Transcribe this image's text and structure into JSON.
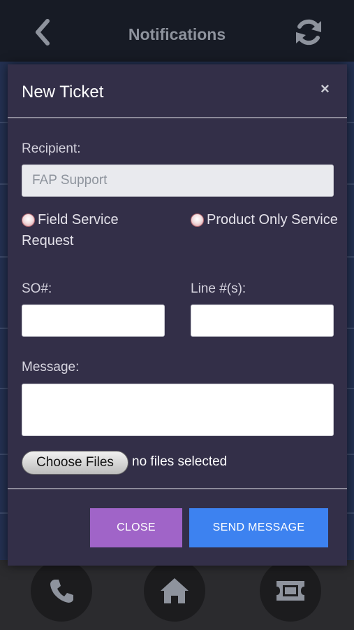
{
  "header": {
    "title": "Notifications",
    "back_icon": "chevron-left-icon",
    "refresh_icon": "refresh-icon"
  },
  "modal": {
    "title": "New Ticket",
    "close_symbol": "×",
    "recipient_label": "Recipient:",
    "recipient_value": "FAP Support",
    "radio_options": [
      {
        "label_line1": "Field Service",
        "label_line2": "Request"
      },
      {
        "label_line1": "Product Only Service",
        "label_line2": ""
      }
    ],
    "so_label": "SO#:",
    "so_value": "",
    "line_label": "Line #(s):",
    "line_value": "",
    "message_label": "Message:",
    "message_value": "",
    "choose_files_label": "Choose Files",
    "files_status": "no files selected",
    "close_button": "CLOSE",
    "send_button": "SEND MESSAGE"
  },
  "colors": {
    "modal_bg": "#332f48",
    "close_button_bg": "#a064c8",
    "send_button_bg": "#3d82f0",
    "topbar_bg": "#171b25"
  },
  "bottom_nav": [
    {
      "icon": "phone-icon"
    },
    {
      "icon": "home-icon"
    },
    {
      "icon": "ticket-icon"
    }
  ]
}
